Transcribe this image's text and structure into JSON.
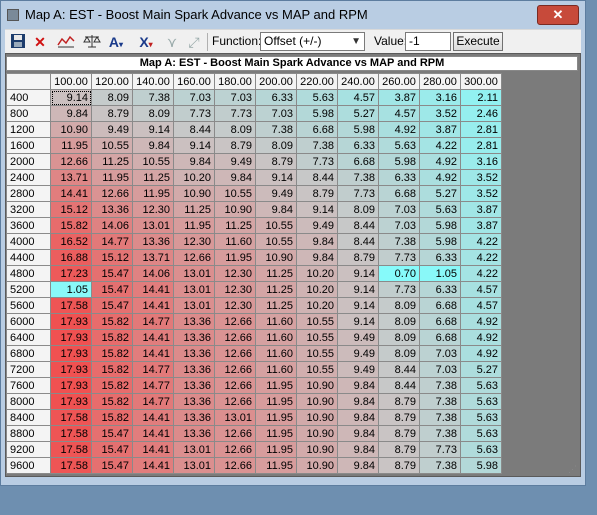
{
  "window": {
    "title": "Map A: EST - Boost Main Spark Advance vs MAP and RPM",
    "close_glyph": "✕"
  },
  "toolbar": {
    "icons": [
      "save-icon",
      "delete-icon",
      "graph-icon",
      "balance-icon",
      "font-icon",
      "clear-format-icon",
      "split-icon",
      "expand-icon"
    ],
    "function_label": "Function:",
    "function_value": "Offset (+/-)",
    "value_label": "Value:",
    "value_input": "-1",
    "execute_label": "Execute"
  },
  "map": {
    "title": "Map A: EST - Boost Main Spark Advance vs MAP and RPM",
    "columns": [
      "100.00",
      "120.00",
      "140.00",
      "160.00",
      "180.00",
      "200.00",
      "220.00",
      "240.00",
      "260.00",
      "280.00",
      "300.00"
    ],
    "rows": [
      "400",
      "800",
      "1200",
      "1600",
      "2000",
      "2400",
      "2800",
      "3200",
      "3600",
      "4000",
      "4400",
      "4800",
      "5200",
      "5600",
      "6000",
      "6400",
      "6800",
      "7200",
      "7600",
      "8000",
      "8400",
      "8800",
      "9200",
      "9600"
    ],
    "cells": [
      [
        "9.14",
        "8.09",
        "7.38",
        "7.03",
        "7.03",
        "6.33",
        "5.63",
        "4.57",
        "3.87",
        "3.16",
        "2.11"
      ],
      [
        "9.84",
        "8.79",
        "8.09",
        "7.73",
        "7.73",
        "7.03",
        "5.98",
        "5.27",
        "4.57",
        "3.52",
        "2.46"
      ],
      [
        "10.90",
        "9.49",
        "9.14",
        "8.44",
        "8.09",
        "7.38",
        "6.68",
        "5.98",
        "4.92",
        "3.87",
        "2.81"
      ],
      [
        "11.95",
        "10.55",
        "9.84",
        "9.14",
        "8.79",
        "8.09",
        "7.38",
        "6.33",
        "5.63",
        "4.22",
        "2.81"
      ],
      [
        "12.66",
        "11.25",
        "10.55",
        "9.84",
        "9.49",
        "8.79",
        "7.73",
        "6.68",
        "5.98",
        "4.92",
        "3.16"
      ],
      [
        "13.71",
        "11.95",
        "11.25",
        "10.20",
        "9.84",
        "9.14",
        "8.44",
        "7.38",
        "6.33",
        "4.92",
        "3.52"
      ],
      [
        "14.41",
        "12.66",
        "11.95",
        "10.90",
        "10.55",
        "9.49",
        "8.79",
        "7.73",
        "6.68",
        "5.27",
        "3.52"
      ],
      [
        "15.12",
        "13.36",
        "12.30",
        "11.25",
        "10.90",
        "9.84",
        "9.14",
        "8.09",
        "7.03",
        "5.63",
        "3.87"
      ],
      [
        "15.82",
        "14.06",
        "13.01",
        "11.95",
        "11.25",
        "10.55",
        "9.49",
        "8.44",
        "7.03",
        "5.98",
        "3.87"
      ],
      [
        "16.52",
        "14.77",
        "13.36",
        "12.30",
        "11.60",
        "10.55",
        "9.84",
        "8.44",
        "7.38",
        "5.98",
        "4.22"
      ],
      [
        "16.88",
        "15.12",
        "13.71",
        "12.66",
        "11.95",
        "10.90",
        "9.84",
        "8.79",
        "7.73",
        "6.33",
        "4.22"
      ],
      [
        "17.23",
        "15.47",
        "14.06",
        "13.01",
        "12.30",
        "11.25",
        "10.20",
        "9.14",
        "0.70",
        "1.05",
        "4.22"
      ],
      [
        "1.05",
        "15.47",
        "14.41",
        "13.01",
        "12.30",
        "11.25",
        "10.20",
        "9.14",
        "7.73",
        "6.33",
        "4.57"
      ],
      [
        "17.58",
        "15.47",
        "14.41",
        "13.01",
        "12.30",
        "11.25",
        "10.20",
        "9.14",
        "8.09",
        "6.68",
        "4.57"
      ],
      [
        "17.93",
        "15.82",
        "14.77",
        "13.36",
        "12.66",
        "11.60",
        "10.55",
        "9.14",
        "8.09",
        "6.68",
        "4.92"
      ],
      [
        "17.93",
        "15.82",
        "14.41",
        "13.36",
        "12.66",
        "11.60",
        "10.55",
        "9.49",
        "8.09",
        "6.68",
        "4.92"
      ],
      [
        "17.93",
        "15.82",
        "14.41",
        "13.36",
        "12.66",
        "11.60",
        "10.55",
        "9.49",
        "8.09",
        "7.03",
        "4.92"
      ],
      [
        "17.93",
        "15.82",
        "14.77",
        "13.36",
        "12.66",
        "11.60",
        "10.55",
        "9.49",
        "8.44",
        "7.03",
        "5.27"
      ],
      [
        "17.93",
        "15.82",
        "14.77",
        "13.36",
        "12.66",
        "11.95",
        "10.90",
        "9.84",
        "8.44",
        "7.38",
        "5.63"
      ],
      [
        "17.93",
        "15.82",
        "14.77",
        "13.36",
        "12.66",
        "11.95",
        "10.90",
        "9.84",
        "8.79",
        "7.38",
        "5.63"
      ],
      [
        "17.58",
        "15.82",
        "14.41",
        "13.36",
        "13.01",
        "11.95",
        "10.90",
        "9.84",
        "8.79",
        "7.38",
        "5.63"
      ],
      [
        "17.58",
        "15.47",
        "14.41",
        "13.36",
        "12.66",
        "11.95",
        "10.90",
        "9.84",
        "8.79",
        "7.38",
        "5.63"
      ],
      [
        "17.58",
        "15.47",
        "14.41",
        "13.01",
        "12.66",
        "11.95",
        "10.90",
        "9.84",
        "8.79",
        "7.73",
        "5.63"
      ],
      [
        "17.58",
        "15.47",
        "14.41",
        "13.01",
        "12.66",
        "11.95",
        "10.90",
        "9.84",
        "8.79",
        "7.38",
        "5.98"
      ]
    ],
    "selected_cell": [
      0,
      0
    ],
    "colors": {
      "hot": "#f05050",
      "mid": "#c8c8c8",
      "cool": "#80ffff",
      "header_bg": "#f4f4f4"
    }
  }
}
